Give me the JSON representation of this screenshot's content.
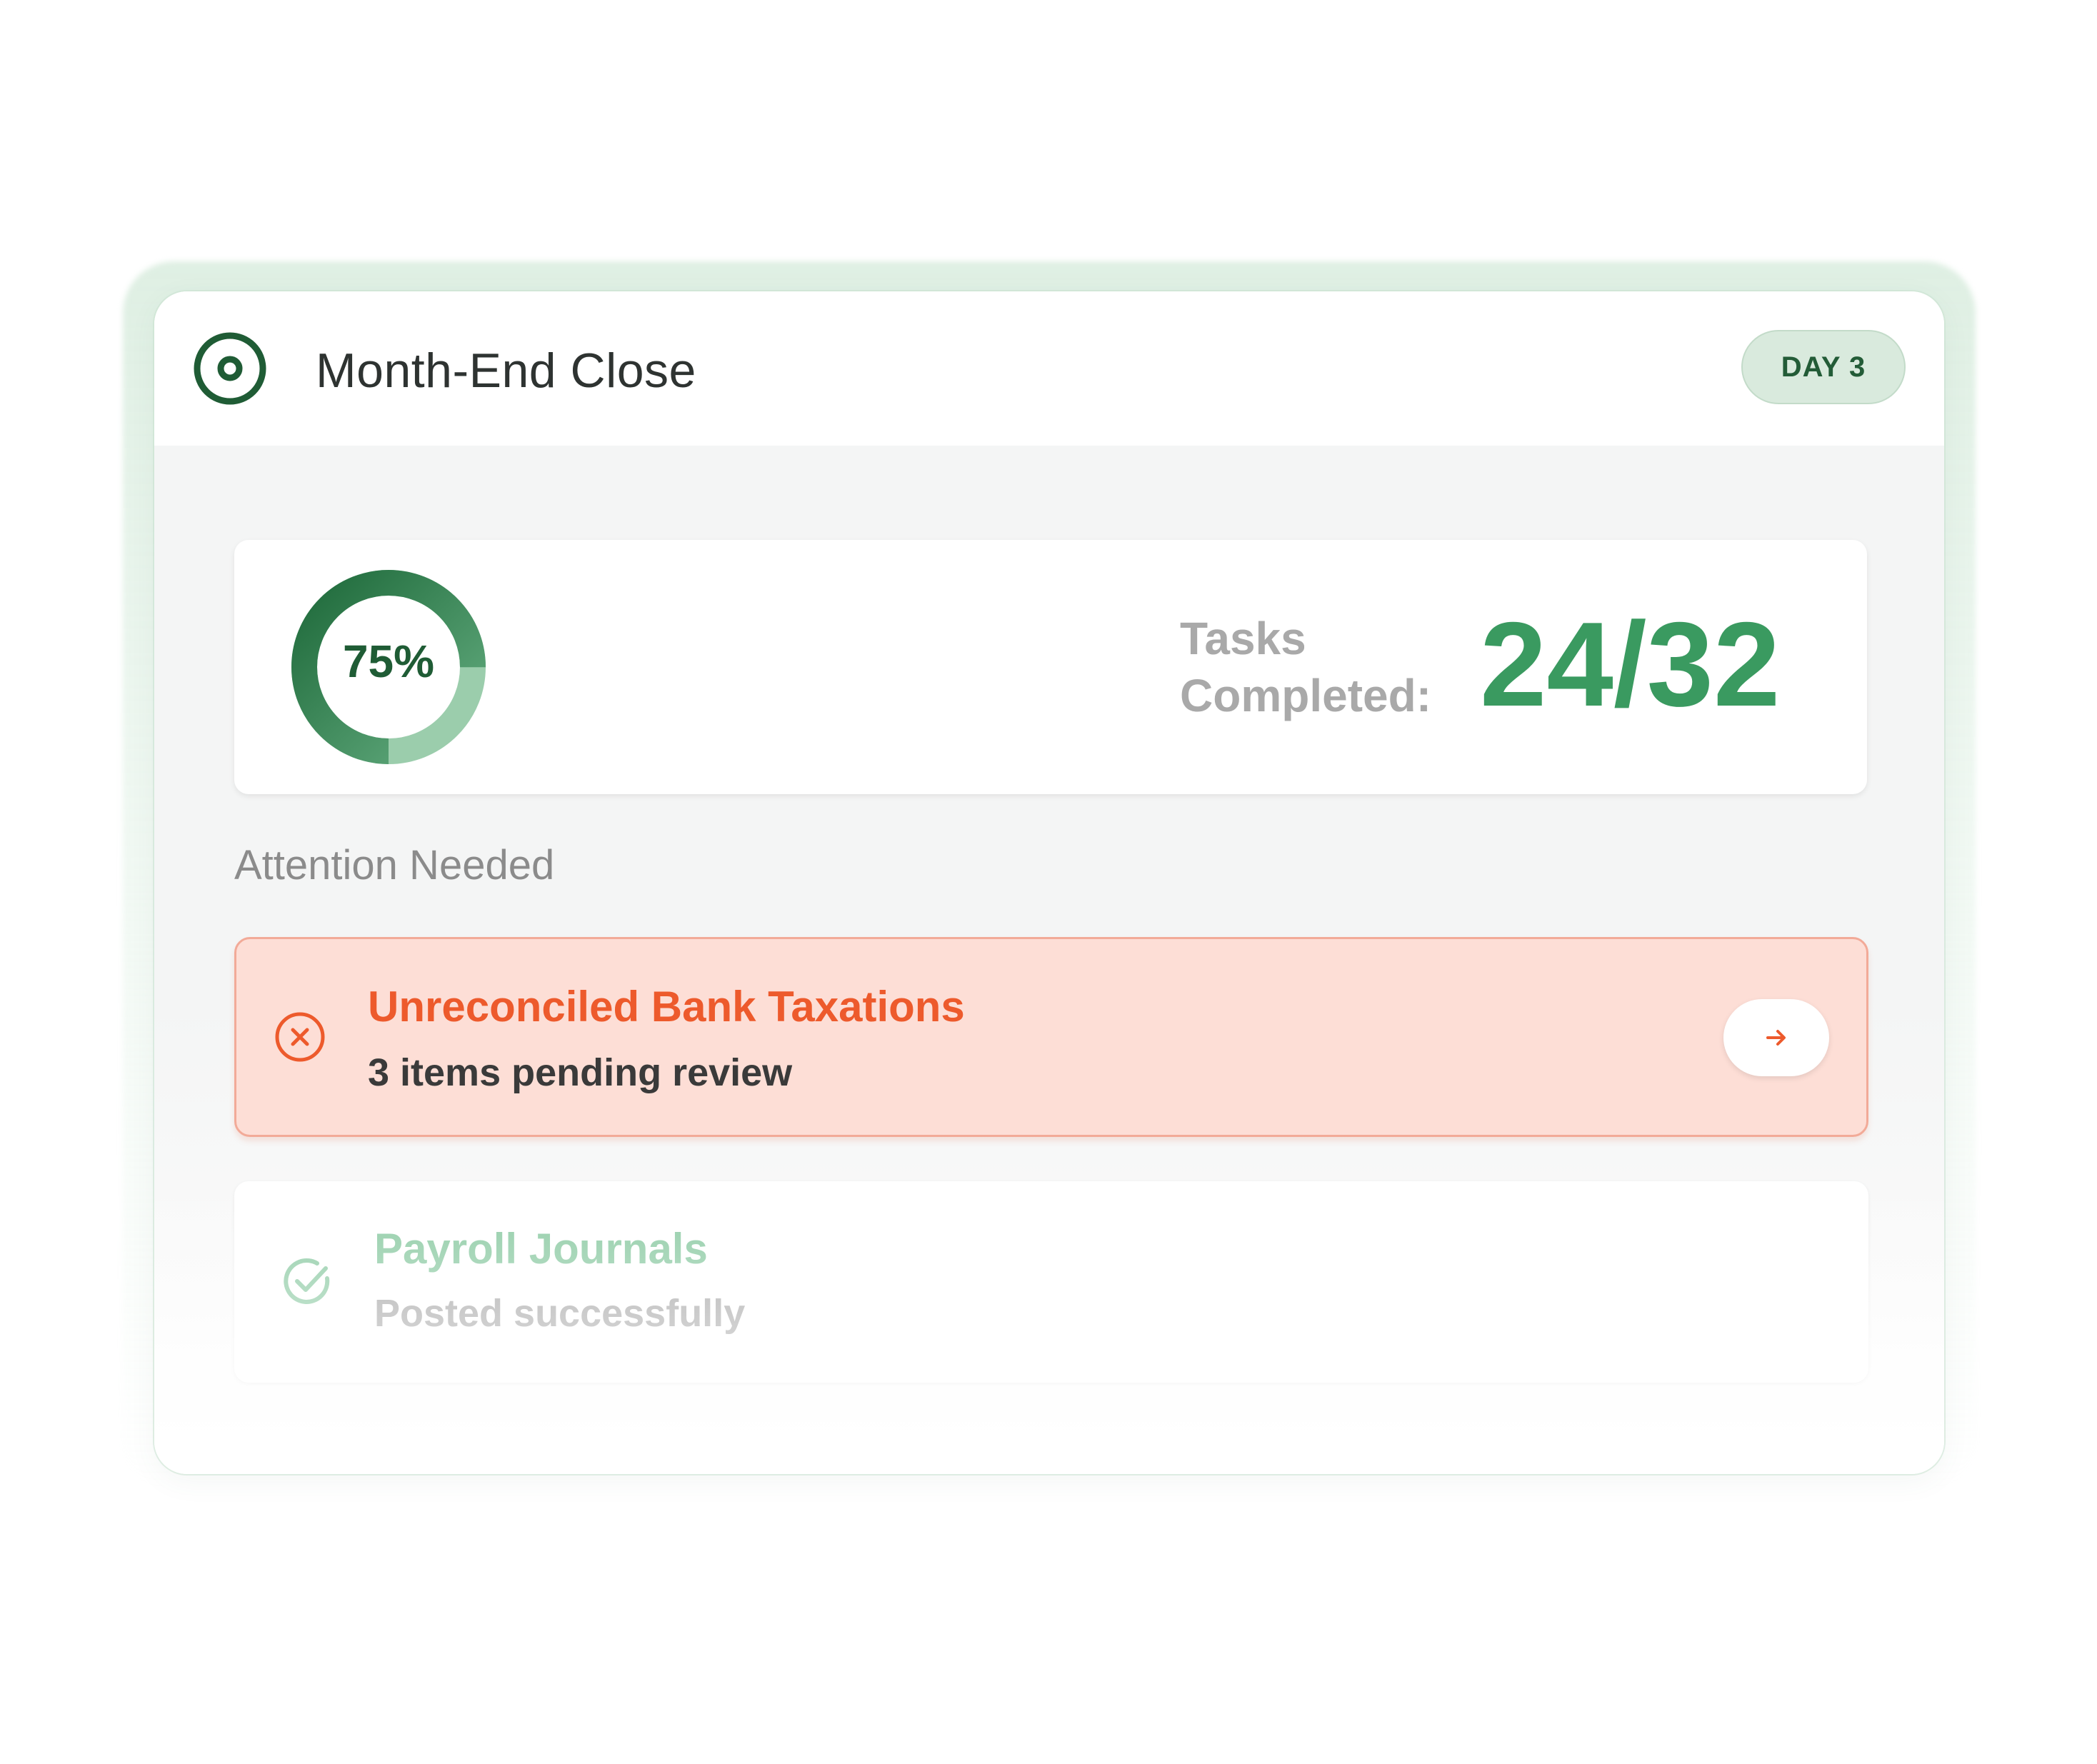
{
  "header": {
    "title": "Month-End Close",
    "icon": "target-icon",
    "day_badge": "DAY 3"
  },
  "progress": {
    "percent_label": "75%",
    "percent_value": 0.75,
    "tasks_label": "Tasks Completed:",
    "tasks_value": "24/32",
    "tasks_done": 24,
    "tasks_total": 32
  },
  "attention": {
    "section_title": "Attention Needed",
    "items": [
      {
        "title": "Unreconciled Bank Taxations",
        "subtitle": "3 items pending review",
        "status": "error",
        "icon": "x-circle-icon",
        "action_icon": "arrow-right-icon"
      },
      {
        "title": "Payroll Journals",
        "subtitle": "Posted successfully",
        "status": "success",
        "icon": "check-circle-icon"
      }
    ]
  },
  "colors": {
    "brand_green": "#1f5c35",
    "value_green": "#3a9a60",
    "alert_orange": "#ed5a2c",
    "alert_bg": "#fdded6",
    "success_green": "#8ccaa3",
    "badge_bg": "#d9eadd"
  }
}
